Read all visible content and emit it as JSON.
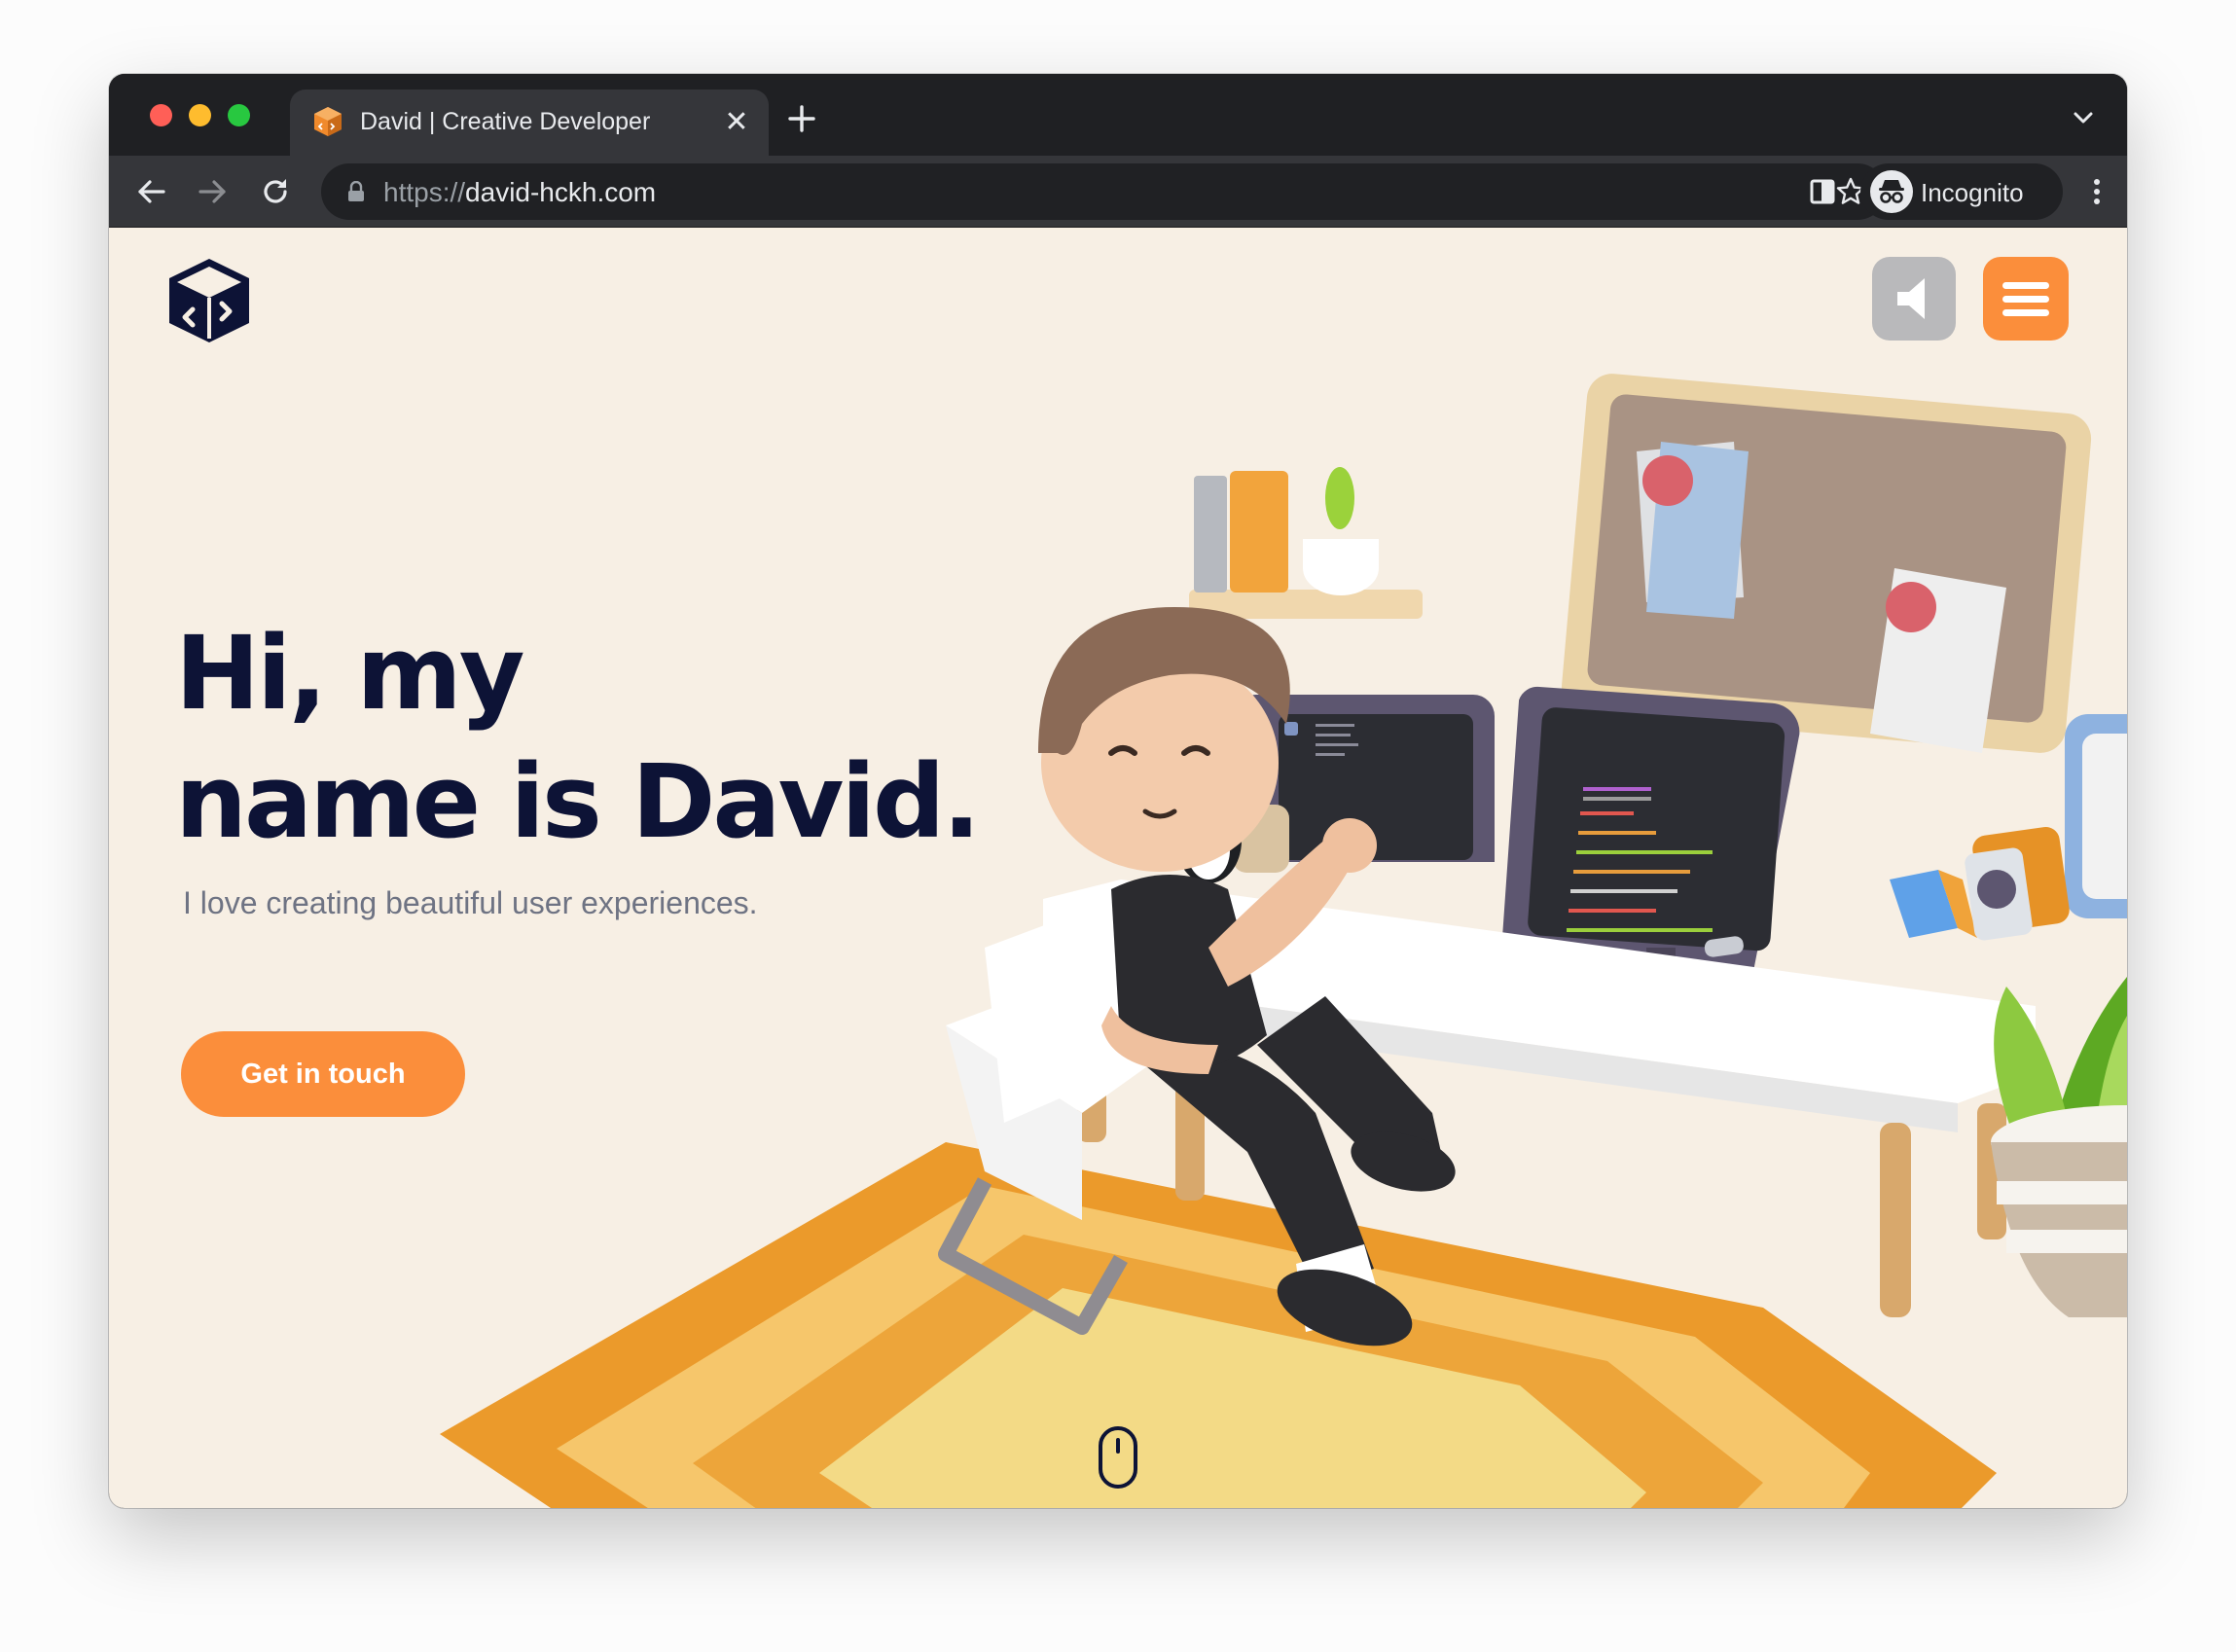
{
  "browser": {
    "tab": {
      "title": "David | Creative Developer",
      "close_glyph": "✕"
    },
    "toolbar": {
      "url_scheme": "https://",
      "url_host": "david-hckh.com",
      "profile_label": "Incognito"
    }
  },
  "page": {
    "headline_line1": "Hi, my",
    "headline_line2": "name is David.",
    "subtitle": "I love creating beautiful user experiences.",
    "cta_label": "Get in touch",
    "colors": {
      "accent": "#fb8e3b",
      "headline": "#0d1336",
      "background": "#f7efe4",
      "subtitle": "#6e7383"
    }
  }
}
